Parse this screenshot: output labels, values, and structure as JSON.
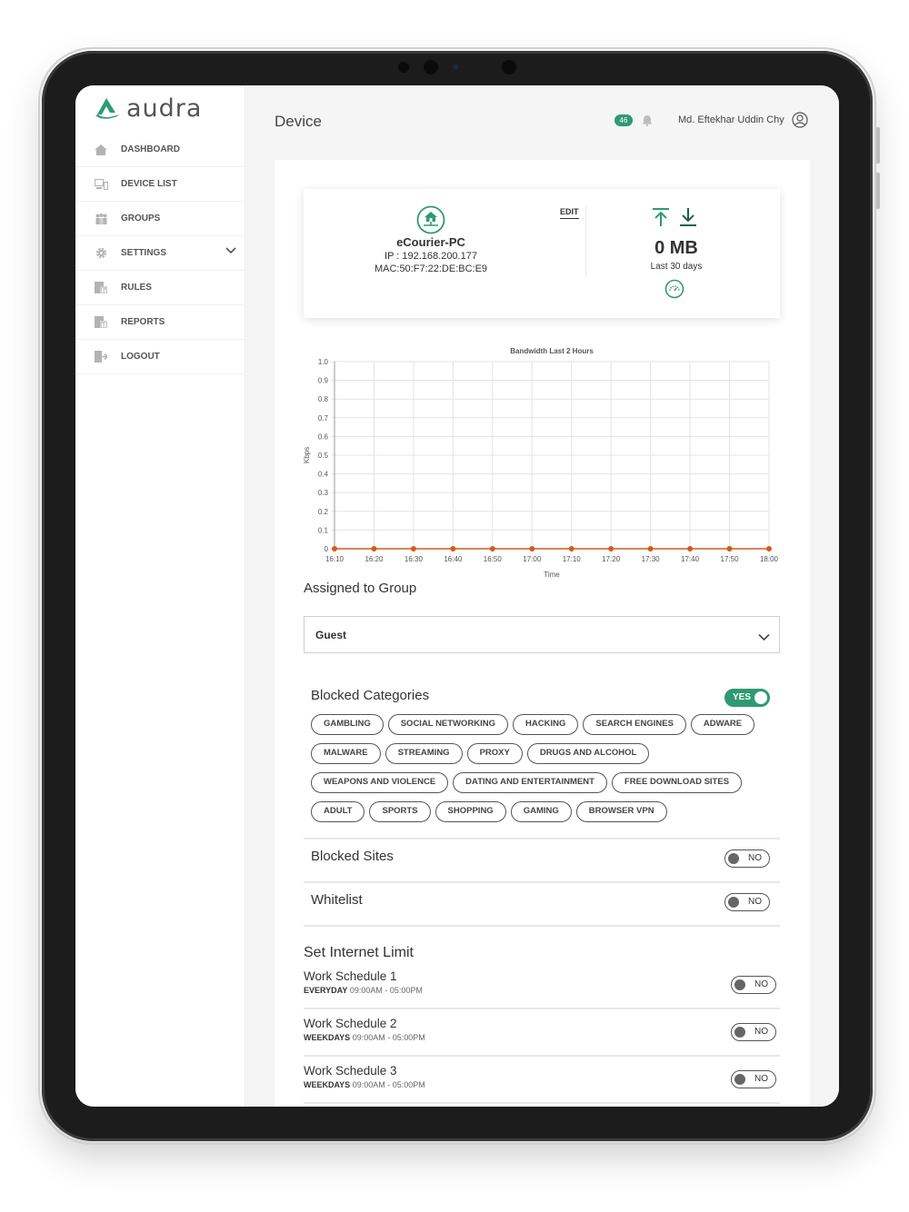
{
  "app": {
    "logo_text": "audra",
    "brand_color": "#2e9a73"
  },
  "sidebar": {
    "items": [
      {
        "label": "DASHBOARD",
        "icon": "home-icon"
      },
      {
        "label": "DEVICE LIST",
        "icon": "device-list-icon"
      },
      {
        "label": "GROUPS",
        "icon": "groups-icon"
      },
      {
        "label": "SETTINGS",
        "icon": "gear-icon"
      },
      {
        "label": "RULES",
        "icon": "rules-icon"
      },
      {
        "label": "REPORTS",
        "icon": "reports-icon"
      },
      {
        "label": "LOGOUT",
        "icon": "logout-icon"
      }
    ]
  },
  "header": {
    "title": "Device",
    "notification_count": "46",
    "user_name": "Md. Eftekhar Uddin Chy"
  },
  "device": {
    "name": "eCourier-PC",
    "ip": "IP : 192.168.200.177",
    "mac": "MAC:50:F7:22:DE:BC:E9",
    "edit_label": "EDIT",
    "usage": "0 MB",
    "usage_period": "Last 30 days"
  },
  "chart_data": {
    "type": "line",
    "title": "Bandwidth Last 2 Hours",
    "xlabel": "Time",
    "ylabel": "Kbps",
    "ylim": [
      0,
      1.0
    ],
    "y_ticks": [
      "0",
      "0.1",
      "0.2",
      "0.3",
      "0.4",
      "0.5",
      "0.6",
      "0.7",
      "0.8",
      "0.9",
      "1.0"
    ],
    "categories": [
      "16:10",
      "16:20",
      "16:30",
      "16:40",
      "16:50",
      "17:00",
      "17:10",
      "17:20",
      "17:30",
      "17:40",
      "17:50",
      "18:00"
    ],
    "series": [
      {
        "values": [
          0,
          0,
          0,
          0,
          0,
          0,
          0,
          0,
          0,
          0,
          0,
          0
        ],
        "color": "#d45a1e"
      }
    ],
    "grid": true
  },
  "group": {
    "title": "Assigned to Group",
    "selected": "Guest"
  },
  "blocked_categories": {
    "title": "Blocked Categories",
    "toggle_label": "YES",
    "rows": [
      [
        "GAMBLING",
        "SOCIAL NETWORKING",
        "HACKING",
        "SEARCH ENGINES",
        "ADWARE"
      ],
      [
        "MALWARE",
        "STREAMING",
        "PROXY",
        "DRUGS AND ALCOHOL"
      ],
      [
        "WEAPONS AND VIOLENCE",
        "DATING AND ENTERTAINMENT",
        "FREE DOWNLOAD SITES"
      ],
      [
        "ADULT",
        "SPORTS",
        "SHOPPING",
        "GAMING",
        "BROWSER VPN"
      ]
    ]
  },
  "blocked_sites": {
    "title": "Blocked Sites",
    "toggle_label": "NO"
  },
  "whitelist": {
    "title": "Whitelist",
    "toggle_label": "NO"
  },
  "internet_limit": {
    "title": "Set Internet Limit",
    "schedules": [
      {
        "name": "Work Schedule 1",
        "days": "EVERYDAY",
        "time": "09:00AM - 05:00PM",
        "toggle_label": "NO"
      },
      {
        "name": "Work Schedule 2",
        "days": "WEEKDAYS",
        "time": "09:00AM - 05:00PM",
        "toggle_label": "NO"
      },
      {
        "name": "Work Schedule 3",
        "days": "WEEKDAYS",
        "time": "09:00AM - 05:00PM",
        "toggle_label": "NO"
      }
    ]
  }
}
